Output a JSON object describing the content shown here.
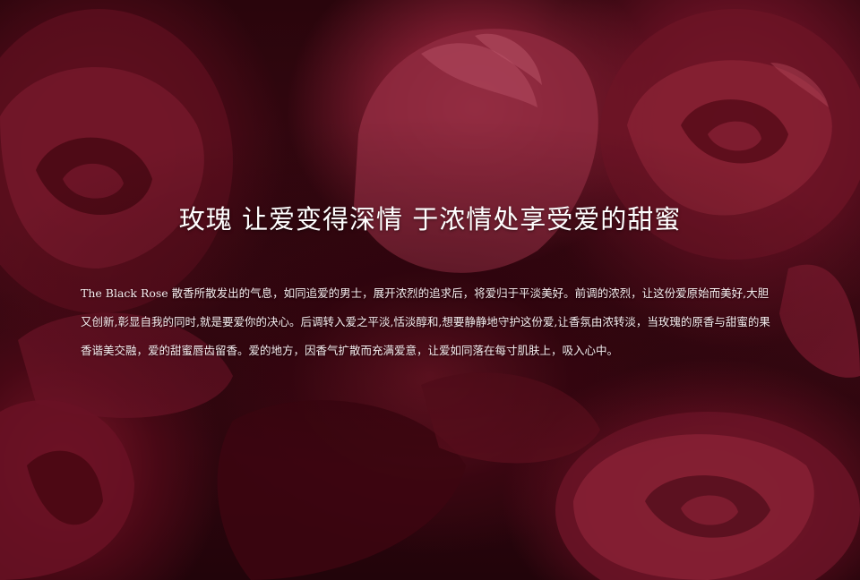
{
  "headline": "玫瑰 让爱变得深情 于浓情处享受爱的甜蜜",
  "description": "The Black Rose 散香所散发出的气息，如同追爱的男士，展开浓烈的追求后，将爱归于平淡美好。前调的浓烈，让这份爱原始而美好,大胆又创新,彰显自我的同时,就是要爱你的决心。后调转入爱之平淡,恬淡醇和,想要静静地守护这份爱,让香氛由浓转淡，当玫瑰的原香与甜蜜的果香谐美交融，爱的甜蜜唇齿留香。爱的地方，因香气扩散而充满爱意，让爱如同落在每寸肌肤上，吸入心中。",
  "colors": {
    "background_dark": "#1a0307",
    "rose_red": "#7a1b2e",
    "rose_highlight": "#a8384e",
    "text": "#ffffff"
  }
}
